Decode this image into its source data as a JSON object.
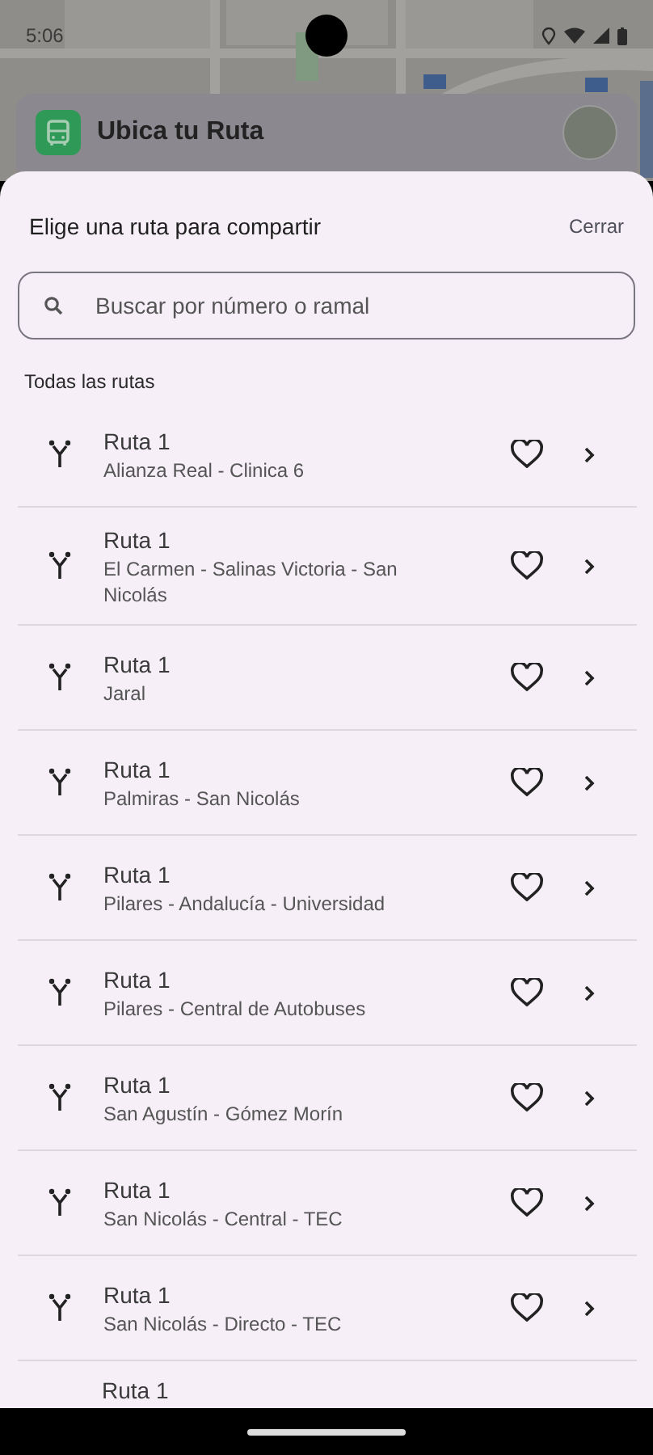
{
  "status_bar": {
    "time": "5:06"
  },
  "app_bar": {
    "title": "Ubica tu Ruta"
  },
  "sheet": {
    "title": "Elige una ruta para compartir",
    "close_label": "Cerrar",
    "search": {
      "placeholder": "Buscar por número o ramal"
    },
    "section_label": "Todas las rutas",
    "routes": [
      {
        "name": "Ruta 1",
        "branch": "Alianza Real - Clinica 6",
        "favorite": false
      },
      {
        "name": "Ruta 1",
        "branch": "El Carmen - Salinas Victoria - San Nicolás",
        "favorite": false
      },
      {
        "name": "Ruta 1",
        "branch": "Jaral",
        "favorite": false
      },
      {
        "name": "Ruta 1",
        "branch": "Palmiras - San Nicolás",
        "favorite": false
      },
      {
        "name": "Ruta 1",
        "branch": "Pilares - Andalucía - Universidad",
        "favorite": false
      },
      {
        "name": "Ruta 1",
        "branch": "Pilares - Central de Autobuses",
        "favorite": false
      },
      {
        "name": "Ruta 1",
        "branch": "San Agustín - Gómez Morín",
        "favorite": false
      },
      {
        "name": "Ruta 1",
        "branch": "San Nicolás - Central - TEC",
        "favorite": false
      },
      {
        "name": "Ruta 1",
        "branch": "San Nicolás - Directo - TEC",
        "favorite": false
      },
      {
        "name": "Ruta 1"
      }
    ]
  }
}
